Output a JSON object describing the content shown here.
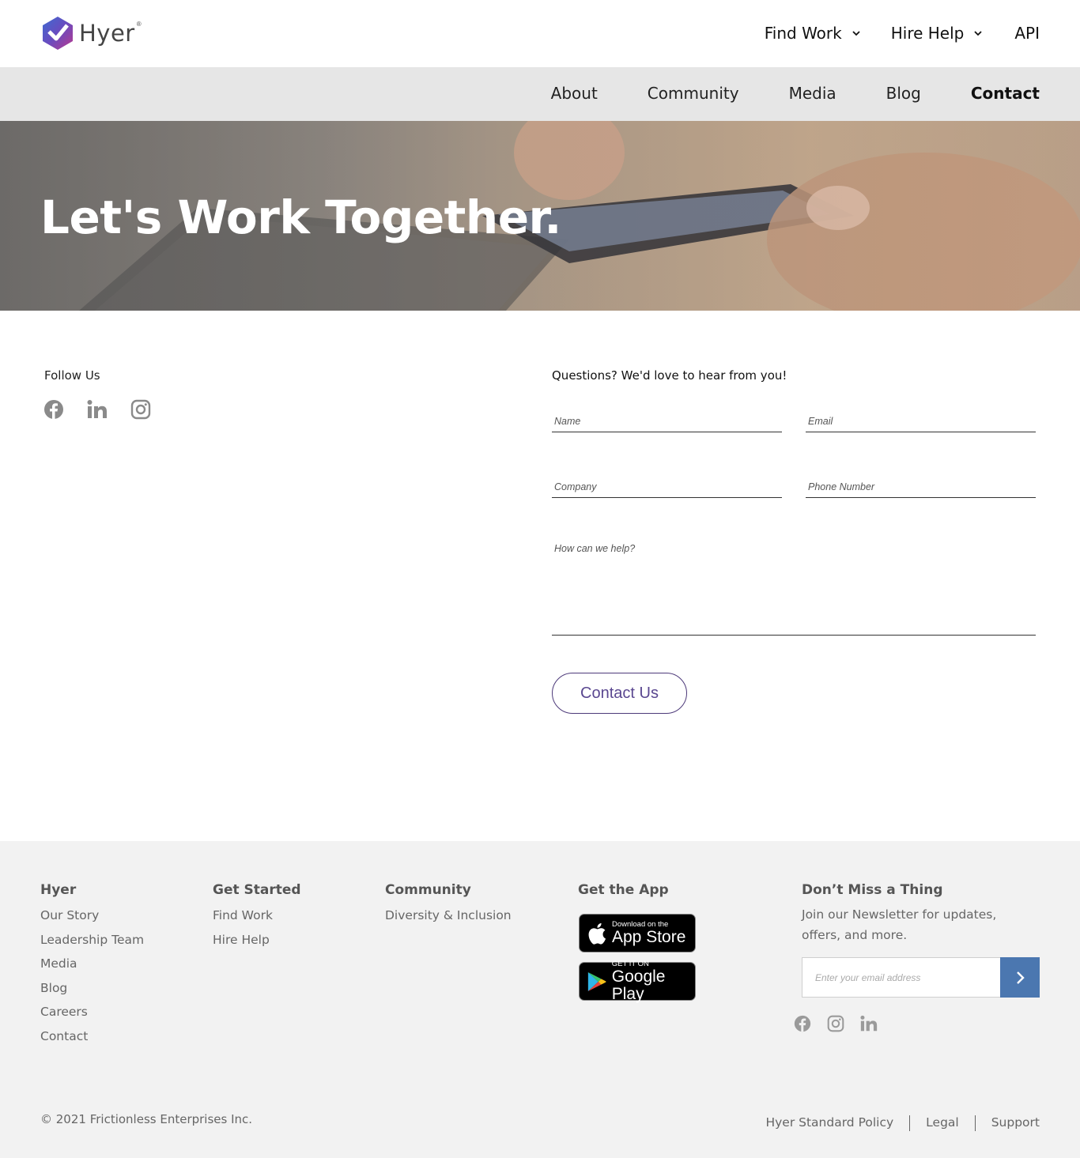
{
  "brand": {
    "name": "Hyer",
    "reg": "®"
  },
  "top_nav": {
    "find_work": "Find Work",
    "hire_help": "Hire Help",
    "api": "API"
  },
  "sub_nav": [
    {
      "label": "About"
    },
    {
      "label": "Community"
    },
    {
      "label": "Media"
    },
    {
      "label": "Blog"
    },
    {
      "label": "Contact",
      "active": true
    }
  ],
  "hero": {
    "title": "Let's Work Together."
  },
  "follow": {
    "label": "Follow Us",
    "icons": [
      "facebook-icon",
      "linkedin-icon",
      "instagram-icon"
    ]
  },
  "form": {
    "heading": "Questions? We'd love to hear from you!",
    "name_placeholder": "Name",
    "email_placeholder": "Email",
    "company_placeholder": "Company",
    "phone_placeholder": "Phone Number",
    "message_placeholder": "How can we help?",
    "submit_label": "Contact Us"
  },
  "footer": {
    "hyer": {
      "heading": "Hyer",
      "links": [
        "Our Story",
        "Leadership Team",
        "Media",
        "Blog",
        "Careers",
        "Contact"
      ]
    },
    "get_started": {
      "heading": "Get Started",
      "links": [
        "Find Work",
        "Hire Help"
      ]
    },
    "community": {
      "heading": "Community",
      "links": [
        "Diversity & Inclusion"
      ]
    },
    "get_app": {
      "heading": "Get the App",
      "app_store_small": "Download on the",
      "app_store_big": "App Store",
      "google_small": "GET IT ON",
      "google_big": "Google Play"
    },
    "newsletter": {
      "heading": "Don’t Miss a Thing",
      "text": "Join our Newsletter for updates, offers, and more.",
      "placeholder": "Enter your email address"
    },
    "copyright": "© 2021 Frictionless Enterprises Inc.",
    "legal": {
      "policy": "Hyer Standard Policy",
      "legal": "Legal",
      "support": "Support"
    }
  },
  "colors": {
    "accent_purple": "#5a4790",
    "newsletter_button": "#4b77b0",
    "footer_bg": "#f2f2f2",
    "subnav_bg": "#e6e6e6"
  }
}
